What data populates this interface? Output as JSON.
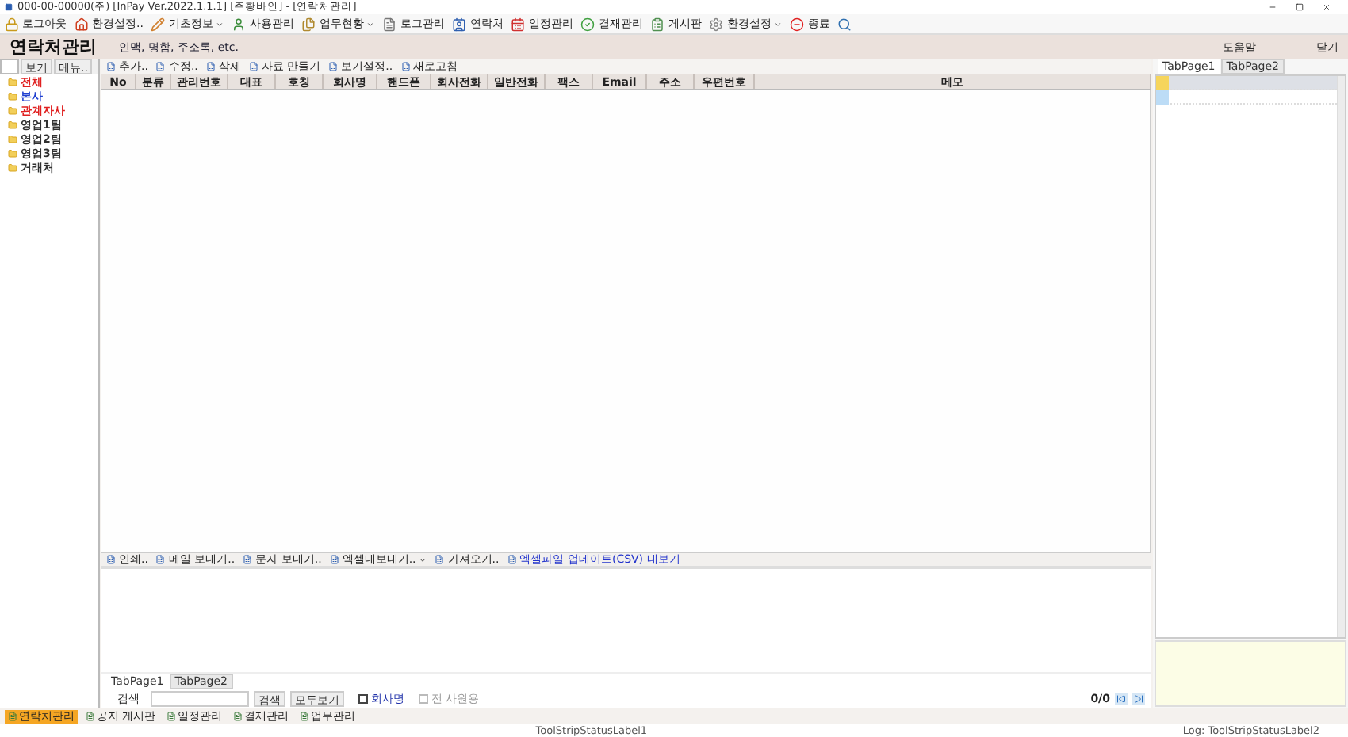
{
  "window": {
    "title": "000-00-00000(주) [InPay Ver.2022.1.1.1] [주황바인] - [연락처관리]"
  },
  "toolbar": [
    {
      "label": "로그아웃",
      "dropdown": false
    },
    {
      "label": "환경설정..",
      "dropdown": false
    },
    {
      "label": "기초정보",
      "dropdown": true
    },
    {
      "label": "사용관리",
      "dropdown": false
    },
    {
      "label": "업무현황",
      "dropdown": true
    },
    {
      "label": "로그관리",
      "dropdown": false
    },
    {
      "label": "연락처",
      "dropdown": false
    },
    {
      "label": "일정관리",
      "dropdown": false
    },
    {
      "label": "결재관리",
      "dropdown": false
    },
    {
      "label": "게시판",
      "dropdown": false
    },
    {
      "label": "환경설정",
      "dropdown": true
    },
    {
      "label": "종료",
      "dropdown": false
    }
  ],
  "header": {
    "title": "연락처관리",
    "subtitle": "인맥, 명함, 주소록, etc.",
    "links": [
      "도움말",
      "닫기"
    ]
  },
  "sidebar": {
    "buttons": [
      "보기",
      "메뉴.."
    ],
    "tree": [
      {
        "label": "전체",
        "color": "#e02020"
      },
      {
        "label": "본사",
        "color": "#2040d0"
      },
      {
        "label": "관계자사",
        "color": "#e02020"
      },
      {
        "label": "영업1팀",
        "color": "#303030"
      },
      {
        "label": "영업2팀",
        "color": "#303030"
      },
      {
        "label": "영업3팀",
        "color": "#303030"
      },
      {
        "label": "거래처",
        "color": "#303030"
      }
    ]
  },
  "grid_toolbar": [
    "추가..",
    "수정..",
    "삭제",
    "자료 만들기",
    "보기설정..",
    "새로고침"
  ],
  "table": {
    "columns": [
      "No",
      "분류",
      "관리번호",
      "대표",
      "호칭",
      "회사명",
      "핸드폰",
      "회사전화",
      "일반전화",
      "팩스",
      "Email",
      "주소",
      "우편번호",
      "메모"
    ]
  },
  "action_toolbar": [
    {
      "label": "인쇄..",
      "dropdown": false,
      "link": false
    },
    {
      "label": "메일 보내기..",
      "dropdown": false,
      "link": false
    },
    {
      "label": "문자 보내기..",
      "dropdown": false,
      "link": false
    },
    {
      "label": "엑셀내보내기..",
      "dropdown": true,
      "link": false
    },
    {
      "label": "가져오기..",
      "dropdown": false,
      "link": false
    },
    {
      "label": "엑셀파일 업데이트(CSV) 내보기",
      "dropdown": false,
      "link": true
    }
  ],
  "bottom_tabs": [
    {
      "label": "TabPage1",
      "selected": true
    },
    {
      "label": "TabPage2",
      "selected": false
    }
  ],
  "search": {
    "label": "검색",
    "buttons": [
      "검색",
      "모두보기"
    ],
    "options": [
      {
        "label": "회사명",
        "checked": false,
        "disabled": false
      },
      {
        "label": "전 사원용",
        "checked": false,
        "disabled": true
      }
    ],
    "pager": "0/0"
  },
  "right_panel": {
    "tabs": [
      {
        "label": "TabPage1",
        "selected": true
      },
      {
        "label": "TabPage2",
        "selected": false
      }
    ],
    "items": [
      {
        "color": "#f6d55c",
        "selected": true
      },
      {
        "color": "#bcdcf6",
        "selected": false
      }
    ]
  },
  "module_tabs": [
    {
      "label": "연락처관리",
      "selected": true
    },
    {
      "label": "공지 게시판",
      "selected": false
    },
    {
      "label": "일정관리",
      "selected": false
    },
    {
      "label": "결재관리",
      "selected": false
    },
    {
      "label": "업무관리",
      "selected": false
    }
  ],
  "status_bar": [
    "ToolStripStatusLabel1",
    "Log: ToolStripStatusLabel2"
  ]
}
